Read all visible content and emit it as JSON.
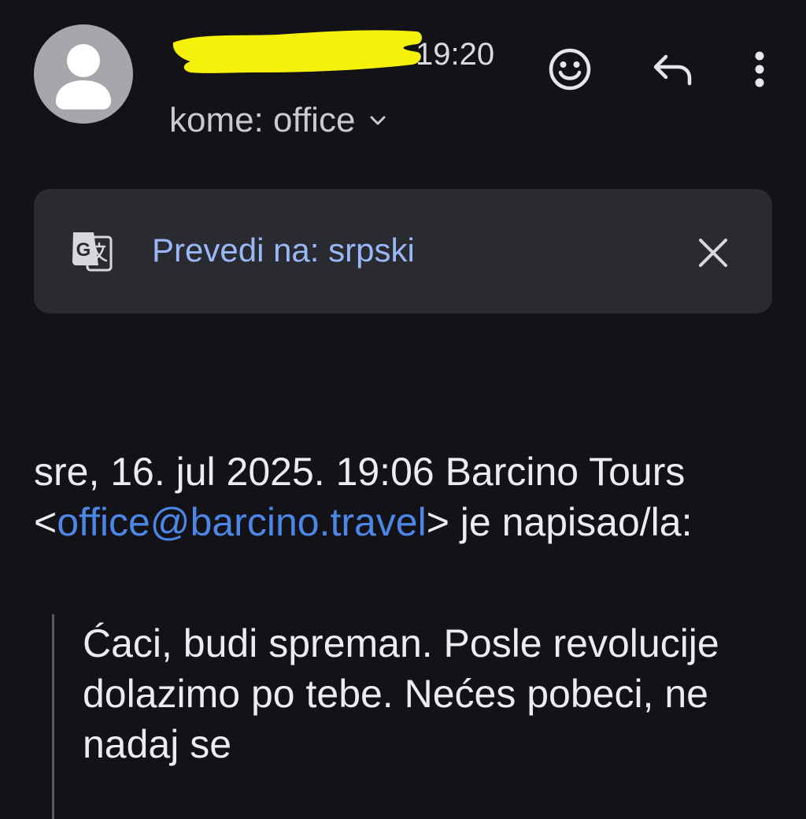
{
  "header": {
    "time": "19:20",
    "recipient_label": "kome: office",
    "redaction_color": "#f5f10a",
    "icons": {
      "avatar": "person-icon",
      "emoji": "emoji-smile-icon",
      "reply": "reply-icon",
      "more": "more-vert-icon",
      "expand": "chevron-down-icon"
    }
  },
  "translate": {
    "label": "Prevedi na: srpski",
    "icon": "translate-icon",
    "close_icon": "close-icon"
  },
  "body": {
    "intro_before_link": "sre, 16. jul 2025. 19:06 Barcino Tours <",
    "sender_email": "office@barcino.travel",
    "intro_after_link": "> je napisao/la:",
    "quoted_text": "Ćaci, budi spreman. Posle revolucije dolazimo po tebe. Nećes pobeci, ne nadaj se"
  },
  "colors": {
    "background": "#121217",
    "translate_bar": "#2a2b31",
    "link": "#4c86e6",
    "translate_link": "#9ab7f7"
  }
}
